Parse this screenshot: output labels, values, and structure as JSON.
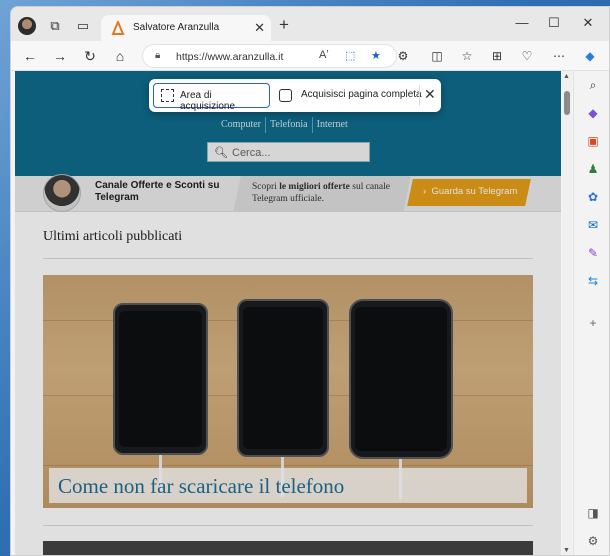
{
  "browser": {
    "tab_title": "Salvatore Aranzulla",
    "url": "https://www.aranzulla.it",
    "minimize": "—",
    "maximize": "☐",
    "close": "✕"
  },
  "capture": {
    "area_label": "Area di acquisizione",
    "full_page_label": "Acquisisci pagina completa"
  },
  "site": {
    "nav": [
      "Computer",
      "Telefonia",
      "Internet"
    ],
    "search_placeholder": "Cerca...",
    "telegram_title": "Canale Offerte e Sconti su Telegram",
    "telegram_desc_pre": "Scopri ",
    "telegram_desc_bold": "le migliori offerte",
    "telegram_desc_post": " sul canale Telegram ufficiale.",
    "telegram_button": "Guarda su Telegram",
    "section_title": "Ultimi articoli pubblicati",
    "hero_title": "Come non far scaricare il telefono"
  },
  "colors": {
    "site_header": "#0f6c8c",
    "telegram_button": "#e8a018",
    "hero_title": "#1f6f93",
    "capture_accent": "#2c62c7"
  }
}
